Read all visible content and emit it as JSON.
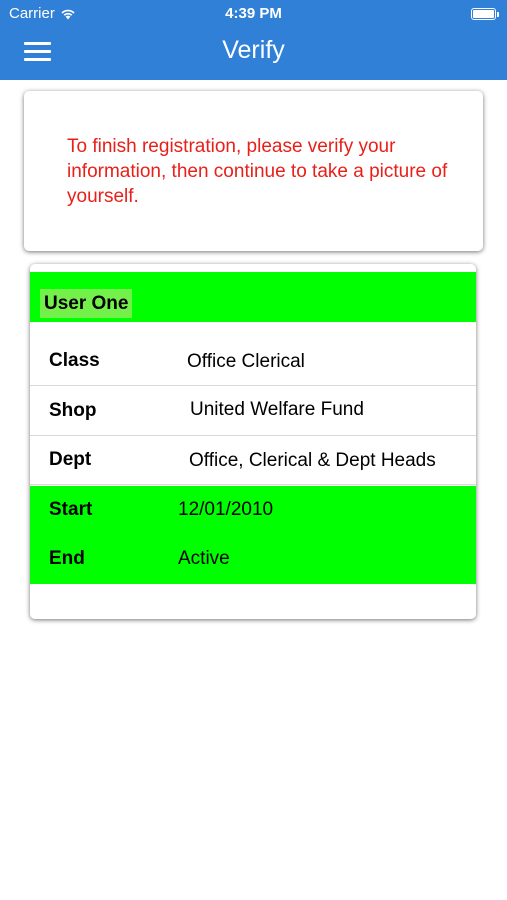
{
  "status_bar": {
    "carrier": "Carrier",
    "time": "4:39 PM"
  },
  "nav": {
    "title": "Verify",
    "menu_icon": "hamburger-menu-icon"
  },
  "notice": {
    "message": "To finish registration, please verify your information, then continue to take a picture of yourself."
  },
  "user": {
    "name": "User One"
  },
  "details": [
    {
      "label": "Class",
      "value": "Office Clerical"
    },
    {
      "label": "Shop",
      "value": "United Welfare Fund"
    },
    {
      "label": "Dept",
      "value": "Office, Clerical & Dept Heads"
    },
    {
      "label": "Start",
      "value": "12/01/2010"
    },
    {
      "label": "End",
      "value": "Active"
    }
  ],
  "colors": {
    "nav_background": "#2f80d6",
    "highlight_green": "#00ff00",
    "notice_text": "#e8201a"
  }
}
